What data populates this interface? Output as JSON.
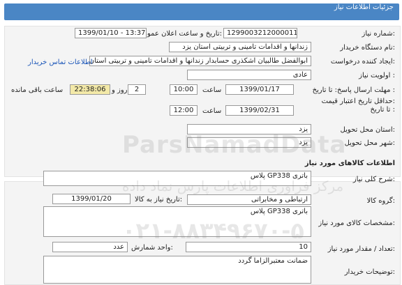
{
  "header": {
    "title": "جزئیات اطلاعات نیاز"
  },
  "labels": {
    "need_number": "شماره نیاز:",
    "announce_datetime": "تاریخ و ساعت اعلان عمومی:",
    "buyer_org": "نام دستگاه خریدار:",
    "requester": "ایجاد کننده درخواست:",
    "priority": "اولویت نیاز :",
    "reply_deadline": "مهلت ارسال پاسخ: تا تاریخ :",
    "min_validity": "حداقل تاریخ اعتبار قیمت:",
    "until_date": "تا تاریخ :",
    "time1": "ساعت",
    "time2": "ساعت",
    "day": "روز و",
    "remaining": "ساعت باقی مانده",
    "province": "استان محل تحویل:",
    "city": "شهر محل تحویل:",
    "goods_section": "اطلاعات کالاهای مورد نیاز",
    "general_desc": "شرح کلی نیاز:",
    "goods_group": "گروه کالا:",
    "need_date": "تاریخ نیاز به کالا:",
    "goods_spec": "مشخصات کالای مورد نیاز:",
    "count": "تعداد / مقدار مورد نیاز:",
    "unit": "واحد شمارش:",
    "buyer_notes": "توضیحات خریدار:"
  },
  "values": {
    "need_number": "1299003212000011",
    "announce_datetime": "1399/01/10 - 13:37",
    "buyer_org": "زندانها و اقدامات تامینی و تربیتی استان یزد",
    "requester": "ابوالفضل  طالبیان اشکذری حسابدار زندانها و اقدامات تامینی و تربیتی استان یزد",
    "contact_link": "اطلاعات تماس خریدار",
    "priority": "عادی",
    "reply_date": "1399/01/17",
    "reply_time": "10:00",
    "days_left": "2",
    "time_left": "22:38:06",
    "validity_date": "1399/02/31",
    "validity_time": "12:00",
    "province": "یزد",
    "city": "یزد",
    "general_desc": "باتری  GP338  پلاس",
    "goods_group": "ارتباطی و مخابراتی",
    "need_date": "1399/01/20",
    "goods_spec": "باتری  GP338  پلاس",
    "count": "10",
    "unit": "عدد",
    "buyer_notes": "ضمانت معتبرالزاما گردد"
  },
  "watermark": {
    "brand": "ParsNamadData",
    "line1": "مرکز فراوری اطلاعات پارس نماد داده",
    "line2": "۰۲۱-۸۸۳۴۹۶۷۰-۵"
  },
  "colors": {
    "header": "#4a86c5",
    "remaining_bg": "#f3e9a8",
    "link": "#1a55b8"
  }
}
